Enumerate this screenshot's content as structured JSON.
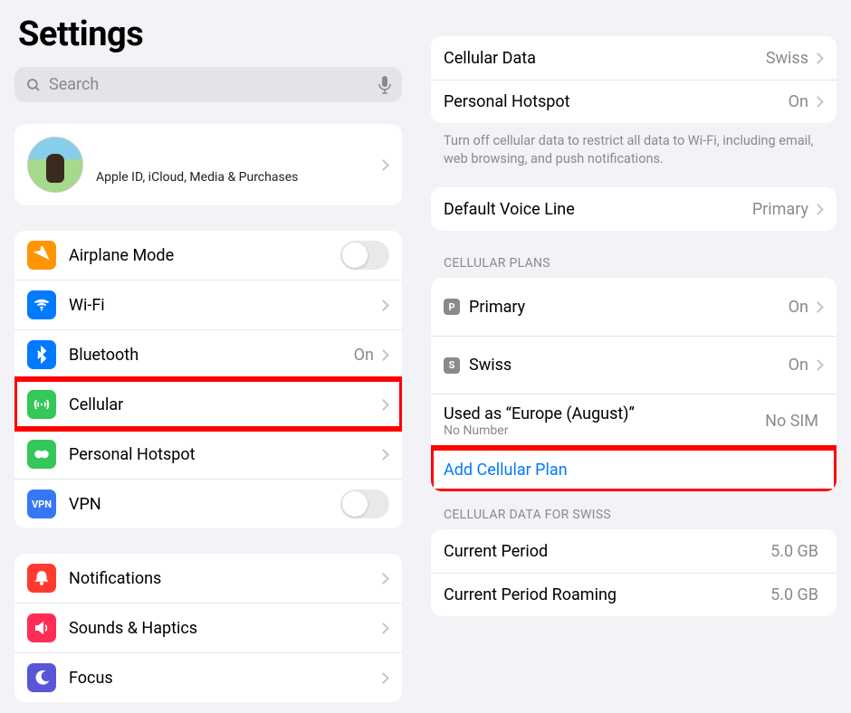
{
  "left": {
    "title": "Settings",
    "search_placeholder": "Search",
    "apple_id": {
      "subtitle": "Apple ID, iCloud, Media & Purchases"
    },
    "group1": {
      "airplane": "Airplane Mode",
      "wifi": "Wi-Fi",
      "bluetooth": "Bluetooth",
      "bluetooth_value": "On",
      "cellular": "Cellular",
      "hotspot": "Personal Hotspot",
      "vpn": "VPN"
    },
    "group2": {
      "notifications": "Notifications",
      "sounds": "Sounds & Haptics",
      "focus": "Focus"
    }
  },
  "right": {
    "cellular_data": {
      "label": "Cellular Data",
      "value": "Swiss"
    },
    "hotspot": {
      "label": "Personal Hotspot",
      "value": "On"
    },
    "footer1": "Turn off cellular data to restrict all data to Wi-Fi, including email, web browsing, and push notifications.",
    "default_voice": {
      "label": "Default Voice Line",
      "value": "Primary"
    },
    "plans_header": "CELLULAR PLANS",
    "plans": {
      "primary": {
        "badge": "P",
        "label": "Primary",
        "value": "On"
      },
      "swiss": {
        "badge": "S",
        "label": "Swiss",
        "value": "On"
      },
      "europe": {
        "label": "Used as “Europe (August)”",
        "sub": "No Number",
        "value": "No SIM"
      },
      "add": "Add Cellular Plan"
    },
    "data_header": "CELLULAR DATA FOR SWISS",
    "usage": {
      "current": {
        "label": "Current Period",
        "value": "5.0 GB"
      },
      "roaming": {
        "label": "Current Period Roaming",
        "value": "5.0 GB"
      }
    }
  },
  "colors": {
    "orange": "#ff9500",
    "blue": "#007aff",
    "blue2": "#0a60ff",
    "green": "#34c759",
    "green2": "#30d158",
    "red": "#ff3b30",
    "pink": "#ff2d55",
    "purple": "#5856d6",
    "navy": "#3478f6"
  }
}
